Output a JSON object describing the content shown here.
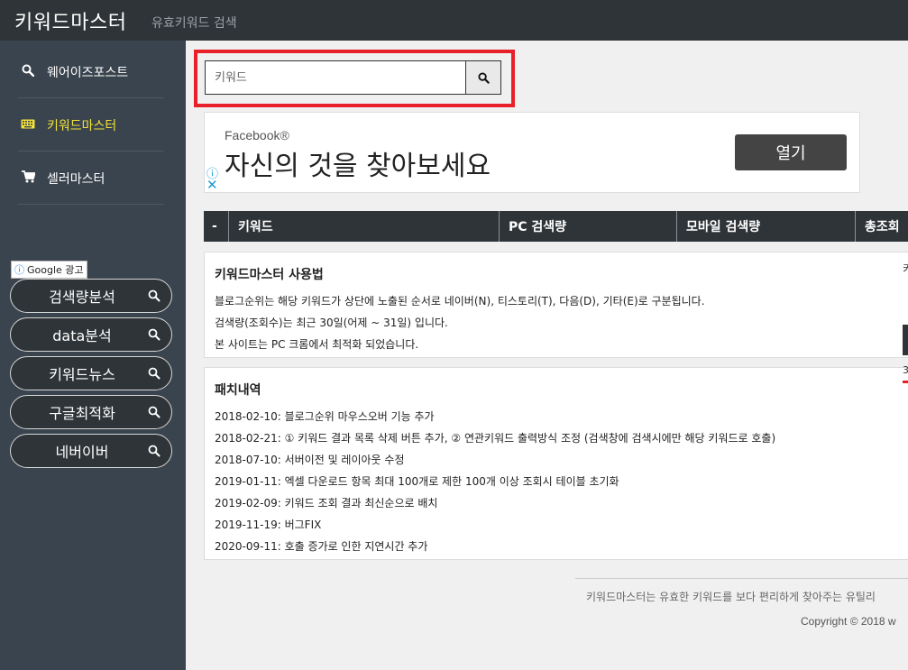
{
  "header": {
    "brand": "키워드마스터",
    "subtitle": "유효키워드 검색"
  },
  "sidebar": {
    "items": [
      {
        "label": "웨어이즈포스트",
        "icon": "search-icon"
      },
      {
        "label": "키워드마스터",
        "icon": "keyboard-icon",
        "active": true
      },
      {
        "label": "셀러마스터",
        "icon": "cart-icon"
      }
    ],
    "google_ad_label": "Google 광고",
    "ad_links": [
      {
        "label": "검색량분석"
      },
      {
        "label": "data분석"
      },
      {
        "label": "키워드뉴스"
      },
      {
        "label": "구글최적화"
      },
      {
        "label": "네버이버"
      }
    ]
  },
  "search": {
    "placeholder": "키워드",
    "value": ""
  },
  "ad": {
    "brand": "Facebook®",
    "title": "자신의 것을 찾아보세요",
    "button": "열기"
  },
  "table": {
    "columns": [
      "-",
      "키워드",
      "PC 검색량",
      "모바일 검색량",
      "총조회"
    ]
  },
  "usage": {
    "title": "키워드마스터 사용법",
    "lines": [
      "블로그순위는 해당 키워드가 상단에 노출된 순서로 네이버(N), 티스토리(T), 다음(D), 기타(E)로 구분됩니다.",
      "검색량(조회수)는 최근 30일(어제 ~ 31일) 입니다.",
      "본 사이트는 PC 크롬에서 최적화 되었습니다."
    ]
  },
  "patch": {
    "title": "패치내역",
    "lines": [
      "2018-02-10: 블로그순위 마우스오버 기능 추가",
      "2018-02-21: ① 키워드 결과 목록 삭제 버튼 추가, ② 연관키워드 출력방식 조정 (검색창에 검색시에만 해당 키워드로 호출)",
      "2018-07-10: 서버이전 및 레이아웃 수정",
      "2019-01-11: 엑셀 다운로드 항목 최대 100개로 제한 100개 이상 조회시 테이블 초기화",
      "2019-02-09: 키워드 조회 결과 최신순으로 배치",
      "2019-11-19: 버그FIX",
      "2020-09-11: 호출 증가로 인한 지연시간 추가"
    ]
  },
  "footer": {
    "description": "키워드마스터는 유효한 키워드를 보다 편리하게 찾아주는 유틸리",
    "copyright": "Copyright © 2018 w"
  },
  "edge_glyphs": {
    "a": "키",
    "b": "3"
  },
  "colors": {
    "topbar": "#2f3438",
    "sidebar": "#3a444e",
    "active": "#f2e23b",
    "highlight_box": "#e8202a"
  }
}
